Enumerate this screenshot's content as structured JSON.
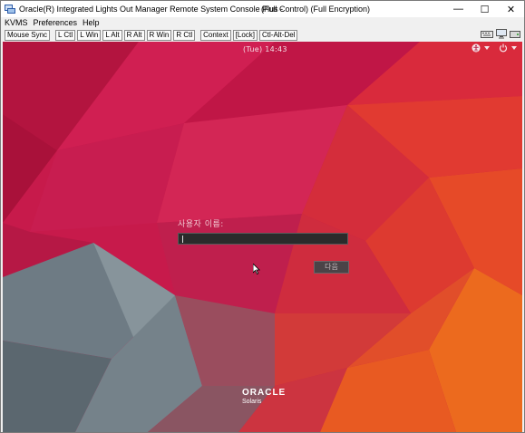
{
  "window": {
    "title": "Oracle(R) Integrated Lights Out Manager Remote System Console Plus -",
    "title_status": "(Full Control) (Full Encryption)",
    "controls": {
      "minimize": "—",
      "maximize": "☐",
      "close": "✕"
    }
  },
  "menu": [
    "KVMS",
    "Preferences",
    "Help"
  ],
  "toolbar": {
    "buttons": [
      "Mouse Sync",
      "L Ctl",
      "L Win",
      "L Alt",
      "R Alt",
      "R Win",
      "R Ctl",
      "Context",
      "[Lock]",
      "Ctl-Alt-Del"
    ],
    "icons": [
      "keyboard-icon",
      "monitor-icon",
      "storage-icon"
    ]
  },
  "console": {
    "clock": "(Tue)  14:43",
    "top_right_icons": [
      "accessibility-icon",
      "power-icon"
    ],
    "login": {
      "label": "사용자 이름:",
      "input_value": "",
      "next_button": "다음"
    },
    "branding": {
      "logo": "ORACLE",
      "product": "Solaris"
    },
    "colors": {
      "accent": "#c8194a",
      "input_bg": "#2b2b2b"
    }
  }
}
